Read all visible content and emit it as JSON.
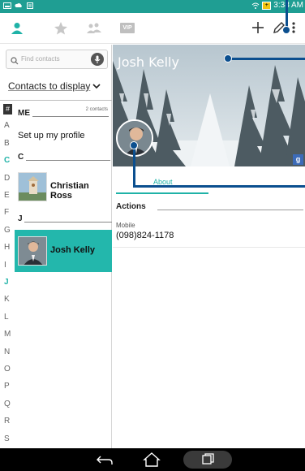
{
  "status_bar": {
    "time": "3:38 AM",
    "battery": "+"
  },
  "tabs": [
    {
      "label": "contacts-tab-icon"
    },
    {
      "label": "favorites-tab-icon"
    },
    {
      "label": "groups-tab-icon"
    },
    {
      "label": "VIP"
    }
  ],
  "search": {
    "placeholder": "Find contacts"
  },
  "contacts_to_display": "Contacts to display",
  "alphabet_index": [
    "#",
    "A",
    "B",
    "C",
    "D",
    "E",
    "F",
    "G",
    "H",
    "I",
    "J",
    "K",
    "L",
    "M",
    "N",
    "O",
    "P",
    "Q",
    "R",
    "S"
  ],
  "active_letters": [
    "C",
    "J"
  ],
  "sections": {
    "me": {
      "header": "ME",
      "count": "2 contacts",
      "profile_row": "Set up my profile"
    },
    "c": {
      "header": "C",
      "contact": "Christian Ross"
    },
    "j": {
      "header": "J",
      "contact": "Josh Kelly"
    }
  },
  "detail": {
    "name": "Josh Kelly",
    "google_badge": "g",
    "tab_about": "About",
    "actions_header": "Actions",
    "phone_label": "Mobile",
    "phone_number": "(098)824-1178"
  },
  "colors": {
    "accent": "#1fb2a7",
    "status_bar": "#1f9e93",
    "selected_row": "#23b7ac",
    "callout": "#0b4f8f"
  }
}
